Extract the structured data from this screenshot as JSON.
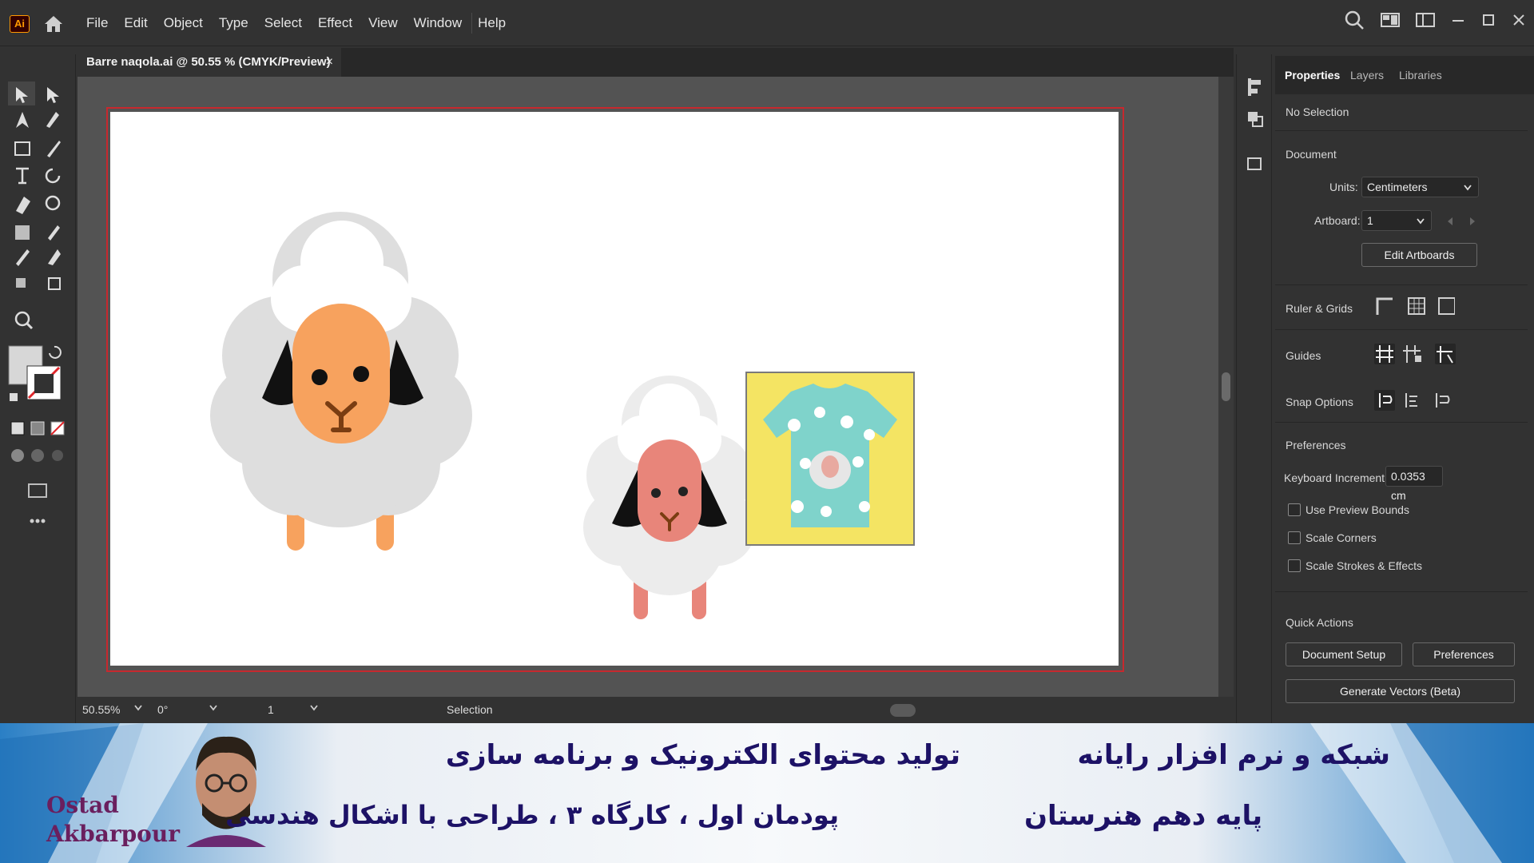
{
  "app": {
    "logo": "Ai"
  },
  "menu": [
    "File",
    "Edit",
    "Object",
    "Type",
    "Select",
    "Effect",
    "View",
    "Window",
    "Help"
  ],
  "document_tab": {
    "title": "Barre naqola.ai @ 50.55 % (CMYK/Preview)",
    "close": "×"
  },
  "statusbar": {
    "zoom": "50.55%",
    "rotation": "0°",
    "artboard": "1",
    "tool": "Selection"
  },
  "panel": {
    "tabs": [
      "Properties",
      "Layers",
      "Libraries"
    ],
    "selection": "No Selection",
    "document_title": "Document",
    "units_label": "Units:",
    "units_value": "Centimeters",
    "artboard_label": "Artboard:",
    "artboard_value": "1",
    "edit_artboards": "Edit Artboards",
    "ruler_grids": "Ruler & Grids",
    "guides": "Guides",
    "snap_options": "Snap Options",
    "preferences_title": "Preferences",
    "keyboard_increment_label": "Keyboard Increment:",
    "keyboard_increment_value": "0.0353 cm",
    "use_preview_bounds": "Use Preview Bounds",
    "scale_corners": "Scale Corners",
    "scale_strokes": "Scale Strokes & Effects",
    "quick_actions": "Quick Actions",
    "document_setup": "Document Setup",
    "preferences_btn": "Preferences",
    "generate_vectors": "Generate Vectors (Beta)"
  },
  "banner": {
    "line1_right": "شبکه و نرم افزار رایانه",
    "line1_left": "تولید محتوای الکترونیک و برنامه سازی",
    "line2_right": "پایه دهم هنرستان",
    "line2_left": "پودمان اول ، کارگاه ۳ ، طراحی با اشکال هندسی",
    "name1": "Ostad",
    "name2": "Akbarpour"
  },
  "colors": {
    "accent": "#ff9a00",
    "artboard_border": "#c7282e",
    "sheep_face": "#f7a25e",
    "wool": "#dedede",
    "banner_text": "#1d1266"
  }
}
